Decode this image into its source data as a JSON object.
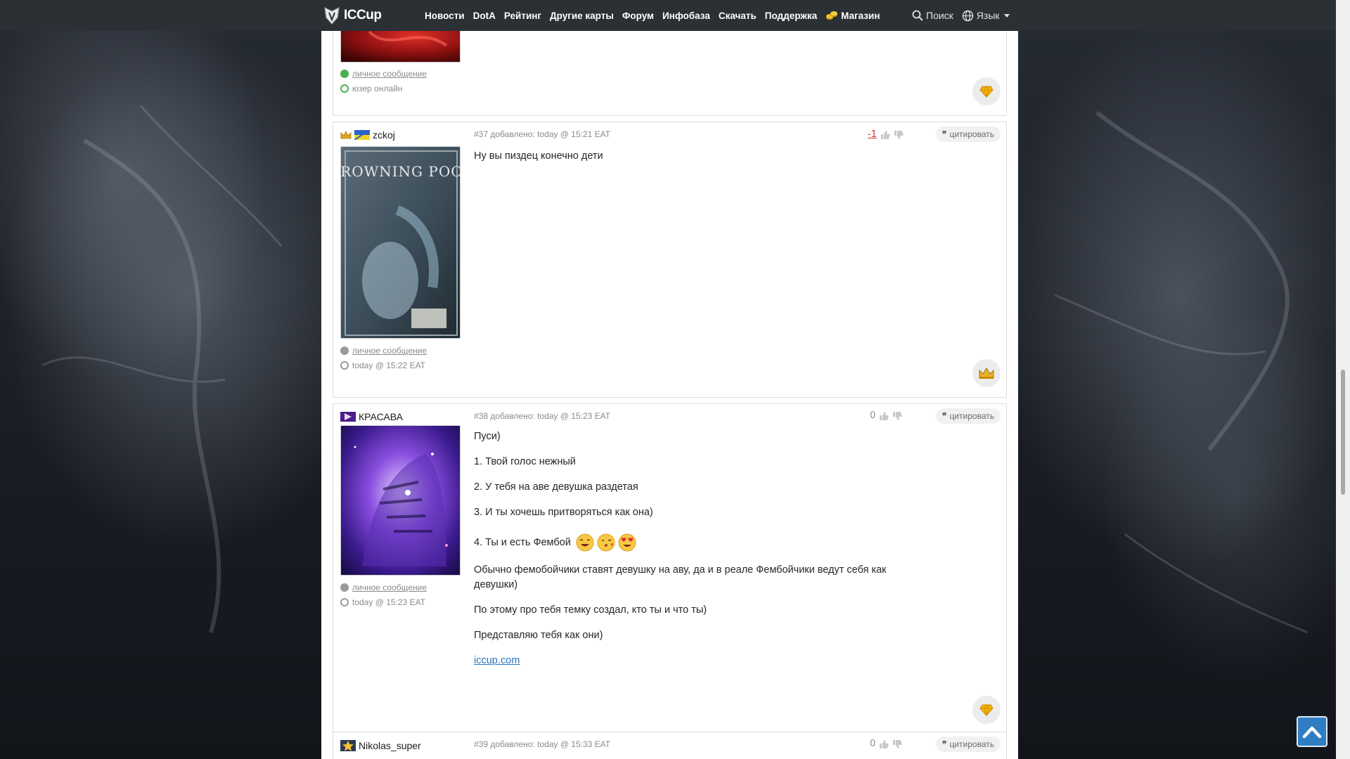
{
  "nav": {
    "logo": "ICCup",
    "items": [
      "Новости",
      "DotA",
      "Рейтинг",
      "Другие карты",
      "Форум",
      "Инфобаза",
      "Скачать",
      "Поддержка"
    ],
    "shop": "Магазин",
    "search": "Поиск",
    "language": "Язык"
  },
  "prev_post": {
    "pm_label": "личное сообщение",
    "status": "юзер онлайн"
  },
  "posts": [
    {
      "username": "zckoj",
      "avatar_title": "DROWNING POOL",
      "number": "#37",
      "added": "добавлено: today @ 15:21 EAT",
      "rating": "-1",
      "quote": "цитировать",
      "pm_label": "личное сообщение",
      "seen": "today @ 15:22 EAT",
      "body": [
        "Ну вы пиздец конечно дети"
      ]
    },
    {
      "username": "КРАСАВА",
      "number": "#38",
      "added": "добавлено: today @ 15:23 EAT",
      "rating": "0",
      "quote": "цитировать",
      "pm_label": "личное сообщение",
      "seen": "today @ 15:23 EAT",
      "body": [
        "Пуси)",
        "1. Твой голос нежный",
        "2. У тебя на аве девушка раздетая",
        "3. И ты хочешь притворяться как она)",
        "4. Ты и есть Фембой",
        "Обычно фемобойчики ставят девушку на аву, да и в реале Фембойчики ведут себя как девушки)",
        "По этому про тебя темку создал, кто ты и что ты)",
        "Представляю тебя как они)"
      ],
      "link": "iccup.com"
    },
    {
      "username": "Nikolas_super",
      "number": "#39",
      "added": "добавлено: today @ 15:33 EAT",
      "rating": "0",
      "quote": "цитировать"
    }
  ]
}
